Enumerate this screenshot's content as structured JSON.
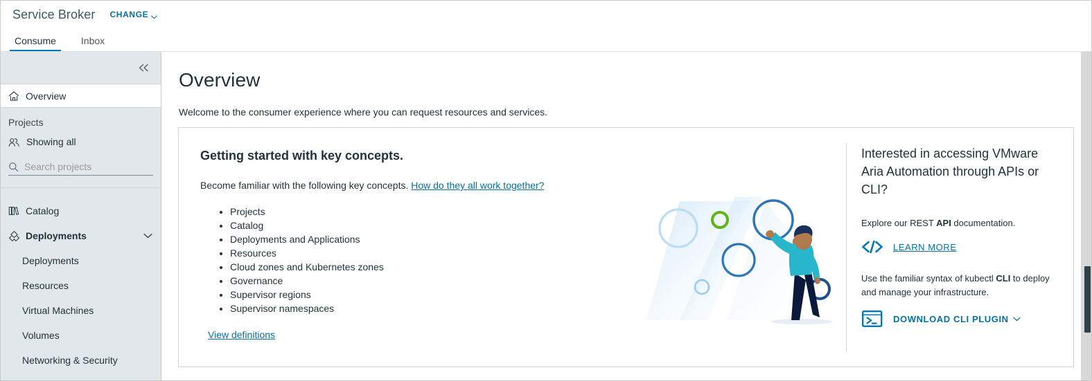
{
  "header": {
    "app_title": "Service Broker",
    "change_label": "CHANGE",
    "tabs": [
      {
        "label": "Consume",
        "active": true
      },
      {
        "label": "Inbox",
        "active": false
      }
    ]
  },
  "sidebar": {
    "collapse_tooltip": "«",
    "overview_label": "Overview",
    "projects_section_label": "Projects",
    "showing_all_label": "Showing all",
    "search_placeholder": "Search projects",
    "search_value": "",
    "nav": [
      {
        "label": "Catalog",
        "icon": "catalog-icon",
        "type": "item"
      },
      {
        "label": "Deployments",
        "icon": "deployments-icon",
        "type": "group",
        "expanded": true
      },
      {
        "label": "Deployments",
        "type": "sub"
      },
      {
        "label": "Resources",
        "type": "sub"
      },
      {
        "label": "Virtual Machines",
        "type": "sub"
      },
      {
        "label": "Volumes",
        "type": "sub"
      },
      {
        "label": "Networking & Security",
        "type": "sub"
      }
    ]
  },
  "main": {
    "page_title": "Overview",
    "welcome": "Welcome to the consumer experience where you can request resources and services.",
    "card": {
      "heading": "Getting started with key concepts.",
      "subtitle_text": "Become familiar with the following key concepts. ",
      "subtitle_link": "How do they all work together?",
      "concepts": [
        "Projects",
        "Catalog",
        "Deployments and Applications",
        "Resources",
        "Cloud zones and Kubernetes zones",
        "Governance",
        "Supervisor regions",
        "Supervisor namespaces"
      ],
      "view_definitions_label": "View definitions",
      "right": {
        "heading": "Interested in accessing VMware Aria Automation through APIs or CLI?",
        "api_text_before": "Explore our REST ",
        "api_text_bold": "API",
        "api_text_after": " documentation.",
        "learn_more_label": "LEARN MORE",
        "cli_text_before": "Use the familiar syntax of kubectl ",
        "cli_text_bold": "CLI",
        "cli_text_after": " to deploy and manage your infrastructure.",
        "download_cli_label": "DOWNLOAD CLI PLUGIN"
      }
    }
  },
  "colors": {
    "accent": "#0072a3",
    "tab_underline": "#0079b8",
    "sidebar_bg": "#e1e7ea",
    "text": "#21333b",
    "scrollbar_thumb": "#31414b",
    "illustration_cyan": "#27b6cc",
    "illustration_navy": "#0b1a3c",
    "illustration_green": "#60b515",
    "illustration_blue": "#2b75bb"
  }
}
